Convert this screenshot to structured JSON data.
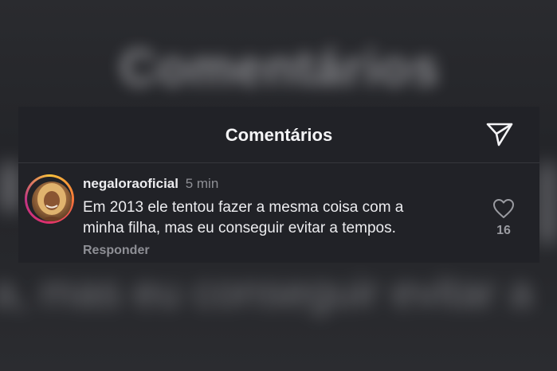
{
  "background": {
    "title": "Comentários",
    "comment_fragment": "a, mas eu conseguir evitar a"
  },
  "header": {
    "title": "Comentários",
    "share_icon": "paper-plane-icon"
  },
  "comment": {
    "username": "negaloraoficial",
    "time": "5 min",
    "text": "Em 2013 ele tentou fazer a mesma coisa com a\nminha filha, mas eu conseguir evitar a tempos.",
    "reply_label": "Responder",
    "like_count": "16",
    "like_icon": "heart-outline-icon"
  },
  "colors": {
    "panel": "#212227",
    "text": "#ececef",
    "muted": "#8e8f95"
  }
}
